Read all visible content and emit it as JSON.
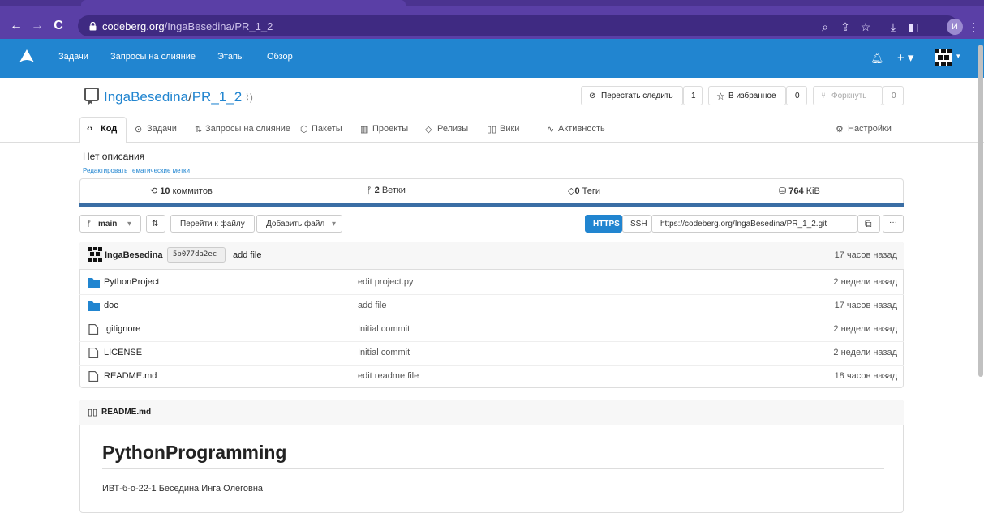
{
  "browser": {
    "url_host": "codeberg.org",
    "url_path": "/IngaBesedina/PR_1_2",
    "profile_initial": "И"
  },
  "site_nav": {
    "items": [
      "Задачи",
      "Запросы на слияние",
      "Этапы",
      "Обзор"
    ]
  },
  "repo": {
    "owner": "IngaBesedina",
    "separator": "/",
    "name": "PR_1_2",
    "unwatch_label": "Перестать следить",
    "watch_count": "1",
    "star_label": "В избранное",
    "star_count": "0",
    "fork_label": "Форкнуть",
    "fork_count": "0"
  },
  "tabs": {
    "code": "Код",
    "issues": "Задачи",
    "pulls": "Запросы на слияние",
    "packages": "Пакеты",
    "projects": "Проекты",
    "releases": "Релизы",
    "wiki": "Вики",
    "activity": "Активность",
    "settings": "Настройки"
  },
  "description": {
    "text": "Нет описания",
    "edit_topics": "Редактировать тематические метки"
  },
  "stats": {
    "commits_num": "10",
    "commits_label": "коммитов",
    "branches_num": "2",
    "branches_label": "Ветки",
    "tags_num": "0",
    "tags_label": "Теги",
    "size_num": "764",
    "size_unit": "KiB"
  },
  "controls": {
    "branch": "main",
    "goto_file": "Перейти к файлу",
    "add_file": "Добавить файл",
    "https": "HTTPS",
    "ssh": "SSH",
    "clone_url": "https://codeberg.org/IngaBesedina/PR_1_2.git"
  },
  "commit": {
    "author": "IngaBesedina",
    "sha": "5b077da2ec",
    "message": "add file",
    "time": "17 часов назад"
  },
  "files": [
    {
      "name": "PythonProject",
      "type": "folder",
      "message": "edit project.py",
      "time": "2 недели назад"
    },
    {
      "name": "doc",
      "type": "folder",
      "message": "add file",
      "time": "17 часов назад"
    },
    {
      "name": ".gitignore",
      "type": "file",
      "message": "Initial commit",
      "time": "2 недели назад"
    },
    {
      "name": "LICENSE",
      "type": "file",
      "message": "Initial commit",
      "time": "2 недели назад"
    },
    {
      "name": "README.md",
      "type": "file",
      "message": "edit readme file",
      "time": "18 часов назад"
    }
  ],
  "readme": {
    "filename": "README.md",
    "heading": "PythonProgramming",
    "line": "ИВТ-б-о-22-1 Беседина Инга Олеговна"
  },
  "colors": {
    "chrome": "#5a3fa6",
    "nav": "#2185d0",
    "link": "#2185d0",
    "https_button": "#2185d0",
    "stats_bar": "#3a6ea5",
    "folder": "#2185d0"
  }
}
